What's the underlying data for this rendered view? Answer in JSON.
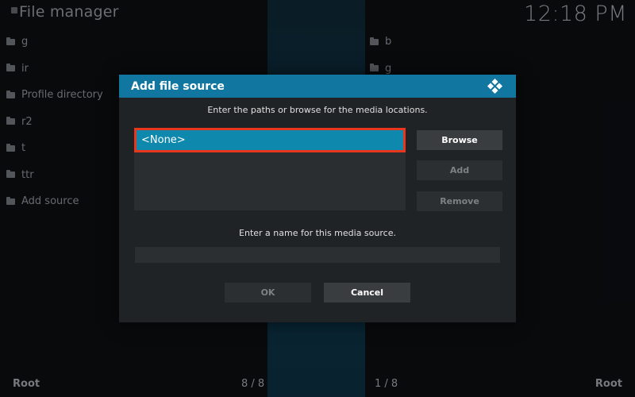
{
  "window": {
    "title": "File manager",
    "clock": "12:18 PM"
  },
  "left_pane": {
    "items": [
      {
        "label": "g",
        "icon": "folder-icon"
      },
      {
        "label": "ir",
        "icon": "folder-icon"
      },
      {
        "label": "Profile directory",
        "icon": "folder-icon"
      },
      {
        "label": "r2",
        "icon": "folder-icon"
      },
      {
        "label": "t",
        "icon": "folder-icon"
      },
      {
        "label": "ttr",
        "icon": "folder-icon"
      },
      {
        "label": "Add source",
        "icon": "folder-icon"
      }
    ]
  },
  "right_pane": {
    "items": [
      {
        "label": "b",
        "icon": "folder-icon"
      },
      {
        "label": "g",
        "icon": "folder-icon"
      }
    ]
  },
  "footer": {
    "left_label": "Root",
    "left_count": "8 / 8",
    "right_count": "1 / 8",
    "right_label": "Root"
  },
  "dialog": {
    "title": "Add file source",
    "logo_icon": "kodi-logo-icon",
    "paths_instruction": "Enter the paths or browse for the media locations.",
    "paths": [
      "<None>"
    ],
    "browse_label": "Browse",
    "add_label": "Add",
    "remove_label": "Remove",
    "name_instruction": "Enter a name for this media source.",
    "name_value": "",
    "ok_label": "OK",
    "cancel_label": "Cancel"
  },
  "colors": {
    "accent": "#1176a0",
    "selection": "#0e88ad",
    "focus_border": "#e8371d",
    "dialog_bg": "#202325"
  }
}
